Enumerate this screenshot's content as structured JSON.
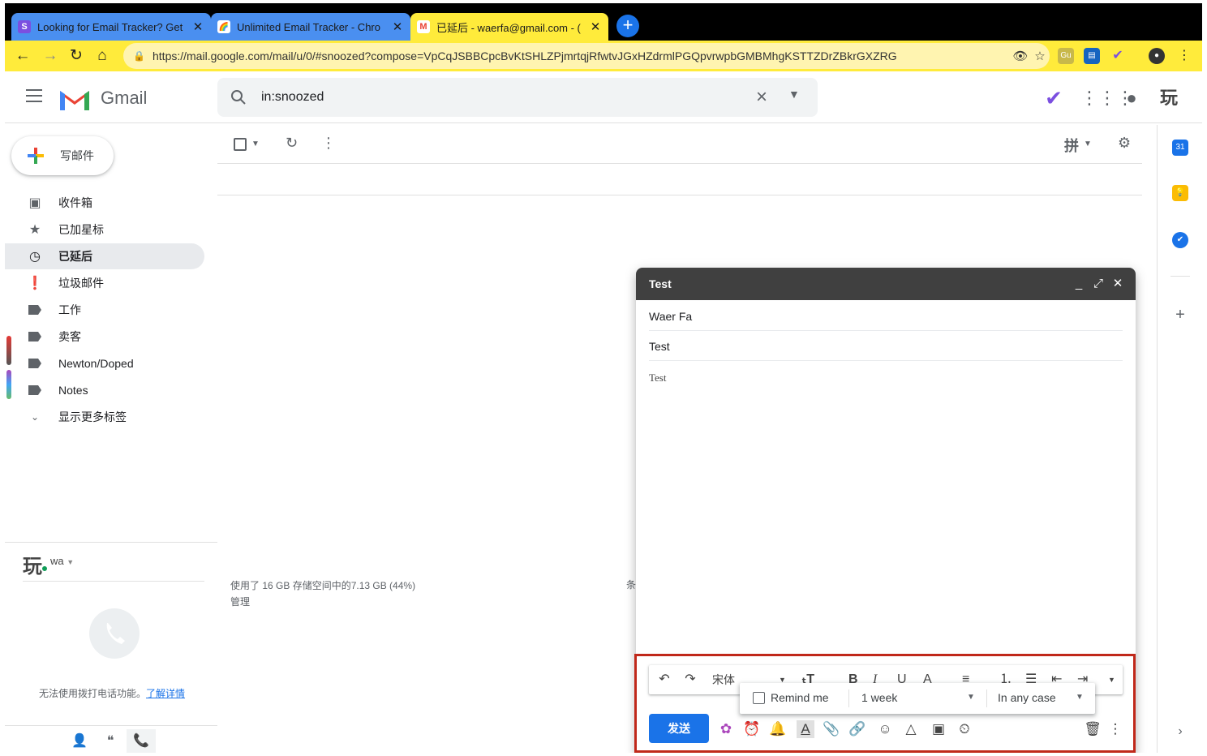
{
  "browser": {
    "tabs": [
      {
        "title": "Looking for Email Tracker? Get",
        "favicon": "S",
        "favicon_color": "#7b4fe0"
      },
      {
        "title": "Unlimited Email Tracker - Chro",
        "favicon": "🌈",
        "favicon_color": "#ffffff"
      },
      {
        "title": "已延后 - waerfa@gmail.com - (",
        "favicon": "M",
        "favicon_color": "#ea4335"
      }
    ],
    "url": "https://mail.google.com/mail/u/0/#snoozed?compose=VpCqJSBBCpcBvKtSHLZPjmrtqjRfwtvJGxHZdrmlPGQpvrwpbGMBMhgKSTTZDrZBkrGXZRG"
  },
  "gmail": {
    "brand": "Gmail",
    "search_query": "in:snoozed",
    "compose_label": "写邮件",
    "nav": [
      {
        "label": "收件箱",
        "icon": "inbox-icon"
      },
      {
        "label": "已加星标",
        "icon": "star-icon"
      },
      {
        "label": "已延后",
        "icon": "clock-icon"
      },
      {
        "label": "垃圾邮件",
        "icon": "spam-icon"
      },
      {
        "label": "工作",
        "icon": "label-icon"
      },
      {
        "label": "卖客",
        "icon": "label-icon"
      },
      {
        "label": "Newton/Doped",
        "icon": "label-icon"
      },
      {
        "label": "Notes",
        "icon": "label-icon"
      },
      {
        "label": "显示更多标签",
        "icon": "chevron-down-icon"
      }
    ],
    "active_nav": "已延后",
    "account_name": "wa",
    "avatar_glyph": "玩",
    "phone_text": "无法使用拨打电话功能。",
    "phone_link": "了解详情",
    "storage_line1": "使用了 16 GB 存储空间中的7.13 GB (44%)",
    "storage_line2": "管理",
    "storage_right": "条",
    "accent": "#1a73e8"
  },
  "compose": {
    "subject": "Test",
    "to": "Waer Fa",
    "subject_field": "Test",
    "body": "Test",
    "font_name": "宋体",
    "send_label": "发送",
    "remind": {
      "checkbox_label": "Remind me",
      "duration": "1 week",
      "condition": "In any case"
    }
  }
}
